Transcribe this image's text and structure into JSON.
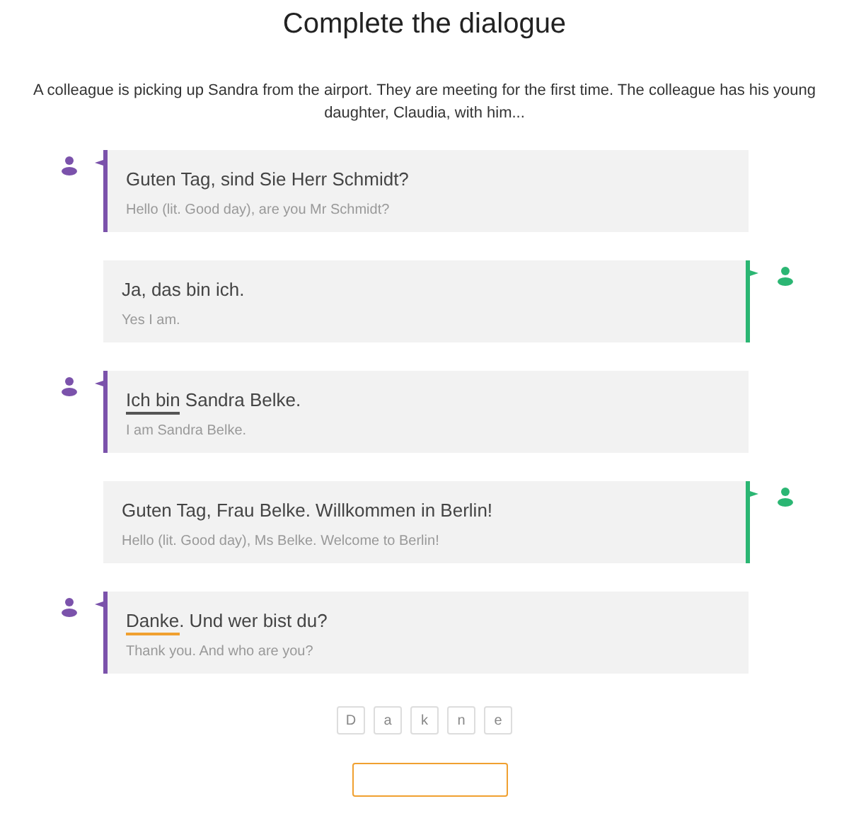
{
  "title": "Complete the dialogue",
  "intro": "A colleague is picking up Sandra from the airport. They are meeting for the first time. The colleague has his young daughter, Claudia, with him...",
  "lines": [
    {
      "kind": "left",
      "color": "#7b52ab",
      "parts": [
        {
          "kind": "plain",
          "text": "Guten Tag, sind Sie Herr Schmidt?"
        }
      ],
      "translation": "Hello (lit. Good day), are you Mr Schmidt?"
    },
    {
      "kind": "right",
      "color": "#2bb673",
      "parts": [
        {
          "kind": "plain",
          "text": "Ja, das bin ich."
        }
      ],
      "translation": "Yes I am."
    },
    {
      "kind": "left",
      "color": "#7b52ab",
      "parts": [
        {
          "kind": "blank",
          "text": "Ich bin",
          "active": false
        },
        {
          "kind": "plain",
          "text": " Sandra Belke."
        }
      ],
      "translation": "I am Sandra Belke."
    },
    {
      "kind": "right",
      "color": "#2bb673",
      "parts": [
        {
          "kind": "plain",
          "text": "Guten Tag, Frau Belke. Willkommen in Berlin!"
        }
      ],
      "translation": "Hello (lit. Good day), Ms Belke. Welcome to Berlin!"
    },
    {
      "kind": "left",
      "color": "#7b52ab",
      "parts": [
        {
          "kind": "blank",
          "text": "Danke",
          "active": true
        },
        {
          "kind": "plain",
          "text": ". Und wer bist du?"
        }
      ],
      "translation": "Thank you. And who are you?"
    }
  ],
  "letters": [
    "D",
    "a",
    "k",
    "n",
    "e"
  ]
}
